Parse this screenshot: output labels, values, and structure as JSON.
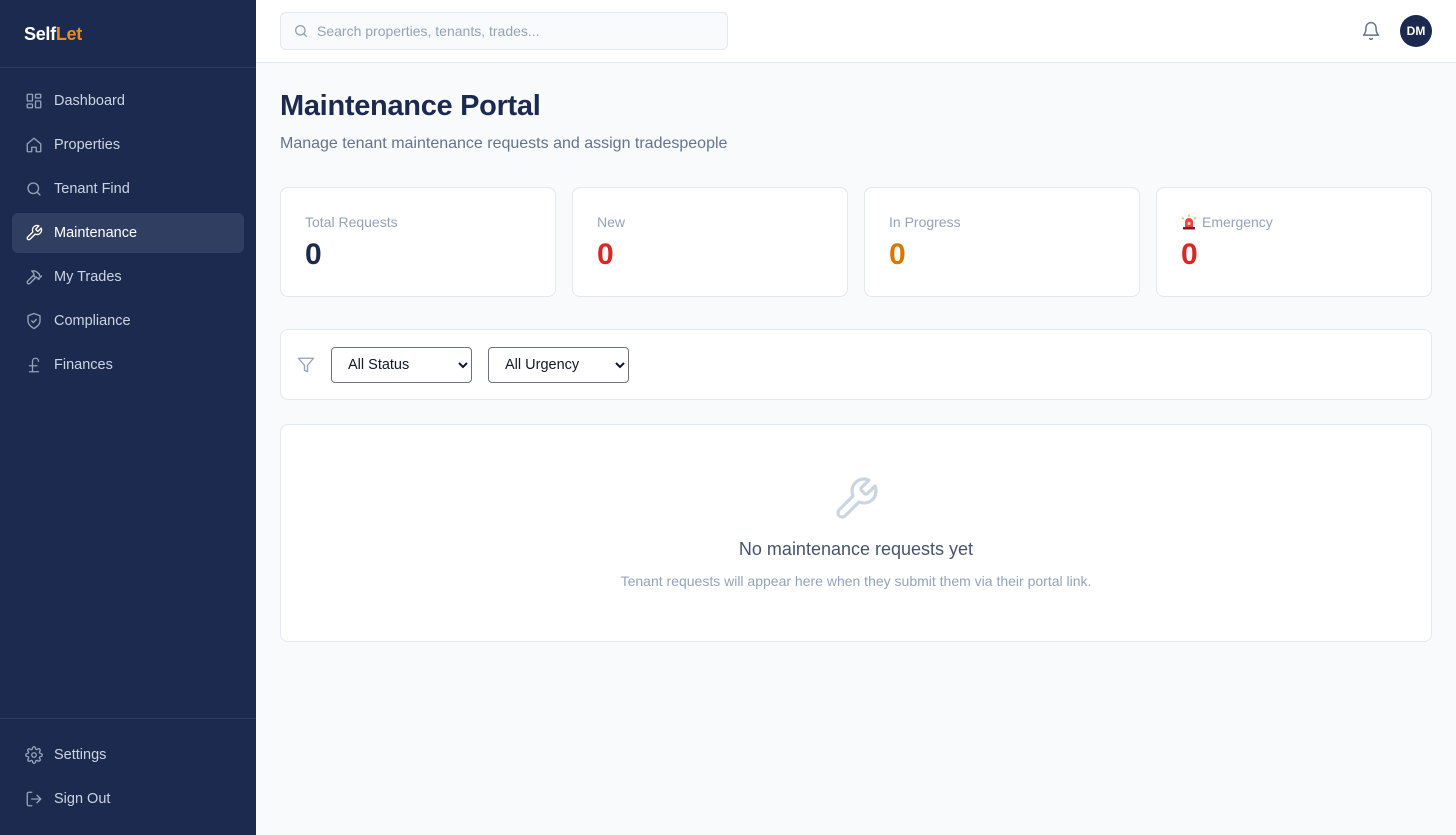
{
  "brand": {
    "part1": "Self",
    "part2": "Let",
    "accent": "#f08a1c"
  },
  "sidebar": {
    "items": [
      {
        "label": "Dashboard",
        "icon": "grid-icon"
      },
      {
        "label": "Properties",
        "icon": "home-icon"
      },
      {
        "label": "Tenant Find",
        "icon": "search-icon"
      },
      {
        "label": "Maintenance",
        "icon": "wrench-icon",
        "active": true
      },
      {
        "label": "My Trades",
        "icon": "hammer-icon"
      },
      {
        "label": "Compliance",
        "icon": "shield-check-icon"
      },
      {
        "label": "Finances",
        "icon": "pound-icon"
      }
    ],
    "bottom": [
      {
        "label": "Settings",
        "icon": "gear-icon"
      },
      {
        "label": "Sign Out",
        "icon": "logout-icon"
      }
    ]
  },
  "topbar": {
    "search_placeholder": "Search properties, tenants, trades...",
    "avatar_initials": "DM"
  },
  "page": {
    "title": "Maintenance Portal",
    "subtitle": "Manage tenant maintenance requests and assign tradespeople"
  },
  "stats": [
    {
      "label": "Total Requests",
      "value": "0",
      "color": "#1b2a4e"
    },
    {
      "label": "New",
      "value": "0",
      "color": "#dc2626"
    },
    {
      "label": "In Progress",
      "value": "0",
      "color": "#d97706"
    },
    {
      "label": "Emergency",
      "value": "0",
      "color": "#dc2626",
      "icon": "siren-icon"
    }
  ],
  "filters": {
    "status_selected": "All Status",
    "urgency_selected": "All Urgency"
  },
  "empty_state": {
    "title": "No maintenance requests yet",
    "subtitle": "Tenant requests will appear here when they submit them via their portal link."
  }
}
